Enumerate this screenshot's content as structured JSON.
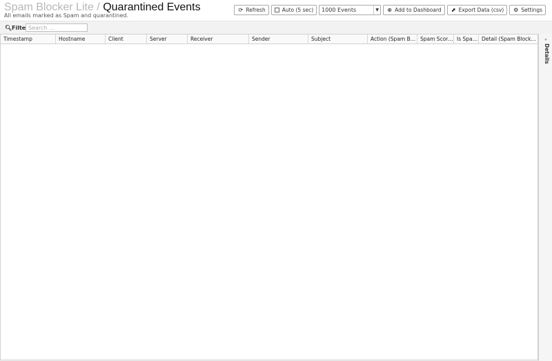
{
  "header": {
    "breadcrumb": "Spam Blocker Lite",
    "separator": "/",
    "title": "Quarantined Events",
    "subtitle": "All emails marked as Spam and quarantined."
  },
  "toolbar": {
    "refresh_label": "Refresh",
    "auto_label": "Auto (5 sec)",
    "events_select": "1000 Events",
    "add_dashboard_label": "Add to Dashboard",
    "export_label": "Export Data (csv)",
    "settings_label": "Settings"
  },
  "filter": {
    "label": "Filter",
    "placeholder": "Search ..."
  },
  "grid": {
    "columns": [
      "Timestamp",
      "Hostname",
      "Client",
      "Server",
      "Receiver",
      "Sender",
      "Subject",
      "Action (Spam Blocker Lite)",
      "Spam Score (Spam Blocker Lite)",
      "Is Spam (Spam Blocker Lite)",
      "Detail (Spam Blocker Lite)"
    ],
    "rows": []
  },
  "side_panel": {
    "label": "Details"
  }
}
